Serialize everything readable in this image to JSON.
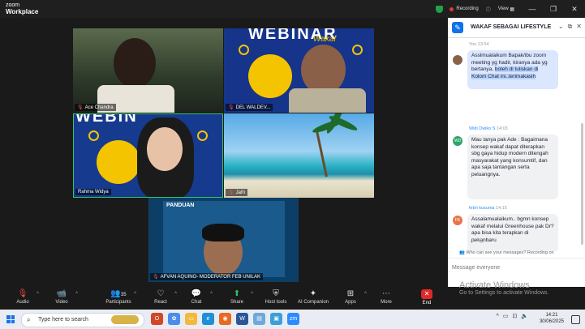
{
  "app": {
    "logo_line1": "zoom",
    "logo_line2": "Workplace"
  },
  "titlebar": {
    "recording": "Recording",
    "view": "View"
  },
  "participants": [
    {
      "name": "Ace Chandra"
    },
    {
      "name": "DEL WALDEV..."
    },
    {
      "name": "Rahma Widya"
    },
    {
      "name": "Jafri"
    },
    {
      "name": "AFVAN AQUINO- MODERATOR FEB UNILAK"
    }
  ],
  "webinar": {
    "title": "WEBINAR",
    "sub": "Wakaf"
  },
  "chat": {
    "title": "WAKAF SEBAGAI LIFESTYLE",
    "messages": [
      {
        "meta": "You 13:54",
        "text_plain": "Asslmualaikum Bapak/ibu zoom meeting yg hadir, kiranya ada yg bertanya, ",
        "text_hl": "boleh di tuliskan di Kolom Chat ini..terimakasih"
      },
      {
        "sender": "Widi Dwiko S",
        "time": "14:03",
        "avatar": "WD",
        "text": "Mau tanya pak Ade : Bagaimana konsep wakaf dapat diterapkan sbg gaya hidup modern ditengah masyarakat yang konsumtif, dan apa saja tantangan serta peluangnya."
      },
      {
        "sender": "febri kusuma",
        "time": "14:15",
        "avatar": "FK",
        "text": "Assalamualaikum.. bgmn konsep wakaf melalui Greenhouse pak Dr? apa bisa kita terapkan di pekanbaru"
      }
    ],
    "who_can_see": "Who can see your messages? Recording on",
    "input_placeholder": "Message everyone",
    "activate_title": "Activate Windows",
    "activate_sub": "Go to Settings to activate Windows."
  },
  "toolbar": {
    "items": [
      {
        "label": "Audio"
      },
      {
        "label": "Video"
      },
      {
        "label": "Participants",
        "count": "35"
      },
      {
        "label": "React"
      },
      {
        "label": "Chat"
      },
      {
        "label": "Share"
      },
      {
        "label": "Host tools"
      },
      {
        "label": "AI Companion"
      },
      {
        "label": "Apps"
      },
      {
        "label": "More"
      }
    ],
    "end": "End"
  },
  "taskbar": {
    "search_placeholder": "Type here to search",
    "time": "14:21",
    "date": "30/06/2025"
  }
}
